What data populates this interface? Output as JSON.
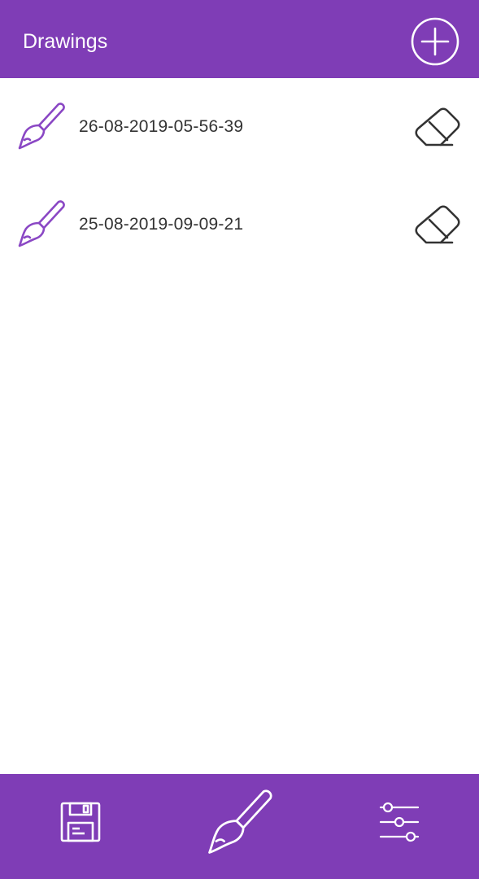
{
  "header": {
    "title": "Drawings",
    "add_icon": "plus-circle-icon"
  },
  "drawings": [
    {
      "name": "26-08-2019-05-56-39",
      "icon": "paintbrush-icon",
      "action_icon": "eraser-icon"
    },
    {
      "name": "25-08-2019-09-09-21",
      "icon": "paintbrush-icon",
      "action_icon": "eraser-icon"
    }
  ],
  "bottom_nav": {
    "items": [
      {
        "icon": "floppy-disk-icon"
      },
      {
        "icon": "paintbrush-icon"
      },
      {
        "icon": "sliders-icon"
      }
    ]
  },
  "colors": {
    "primary": "#7f3db6",
    "accent_icon": "#8a47c4",
    "text": "#333333",
    "background": "#ffffff"
  }
}
